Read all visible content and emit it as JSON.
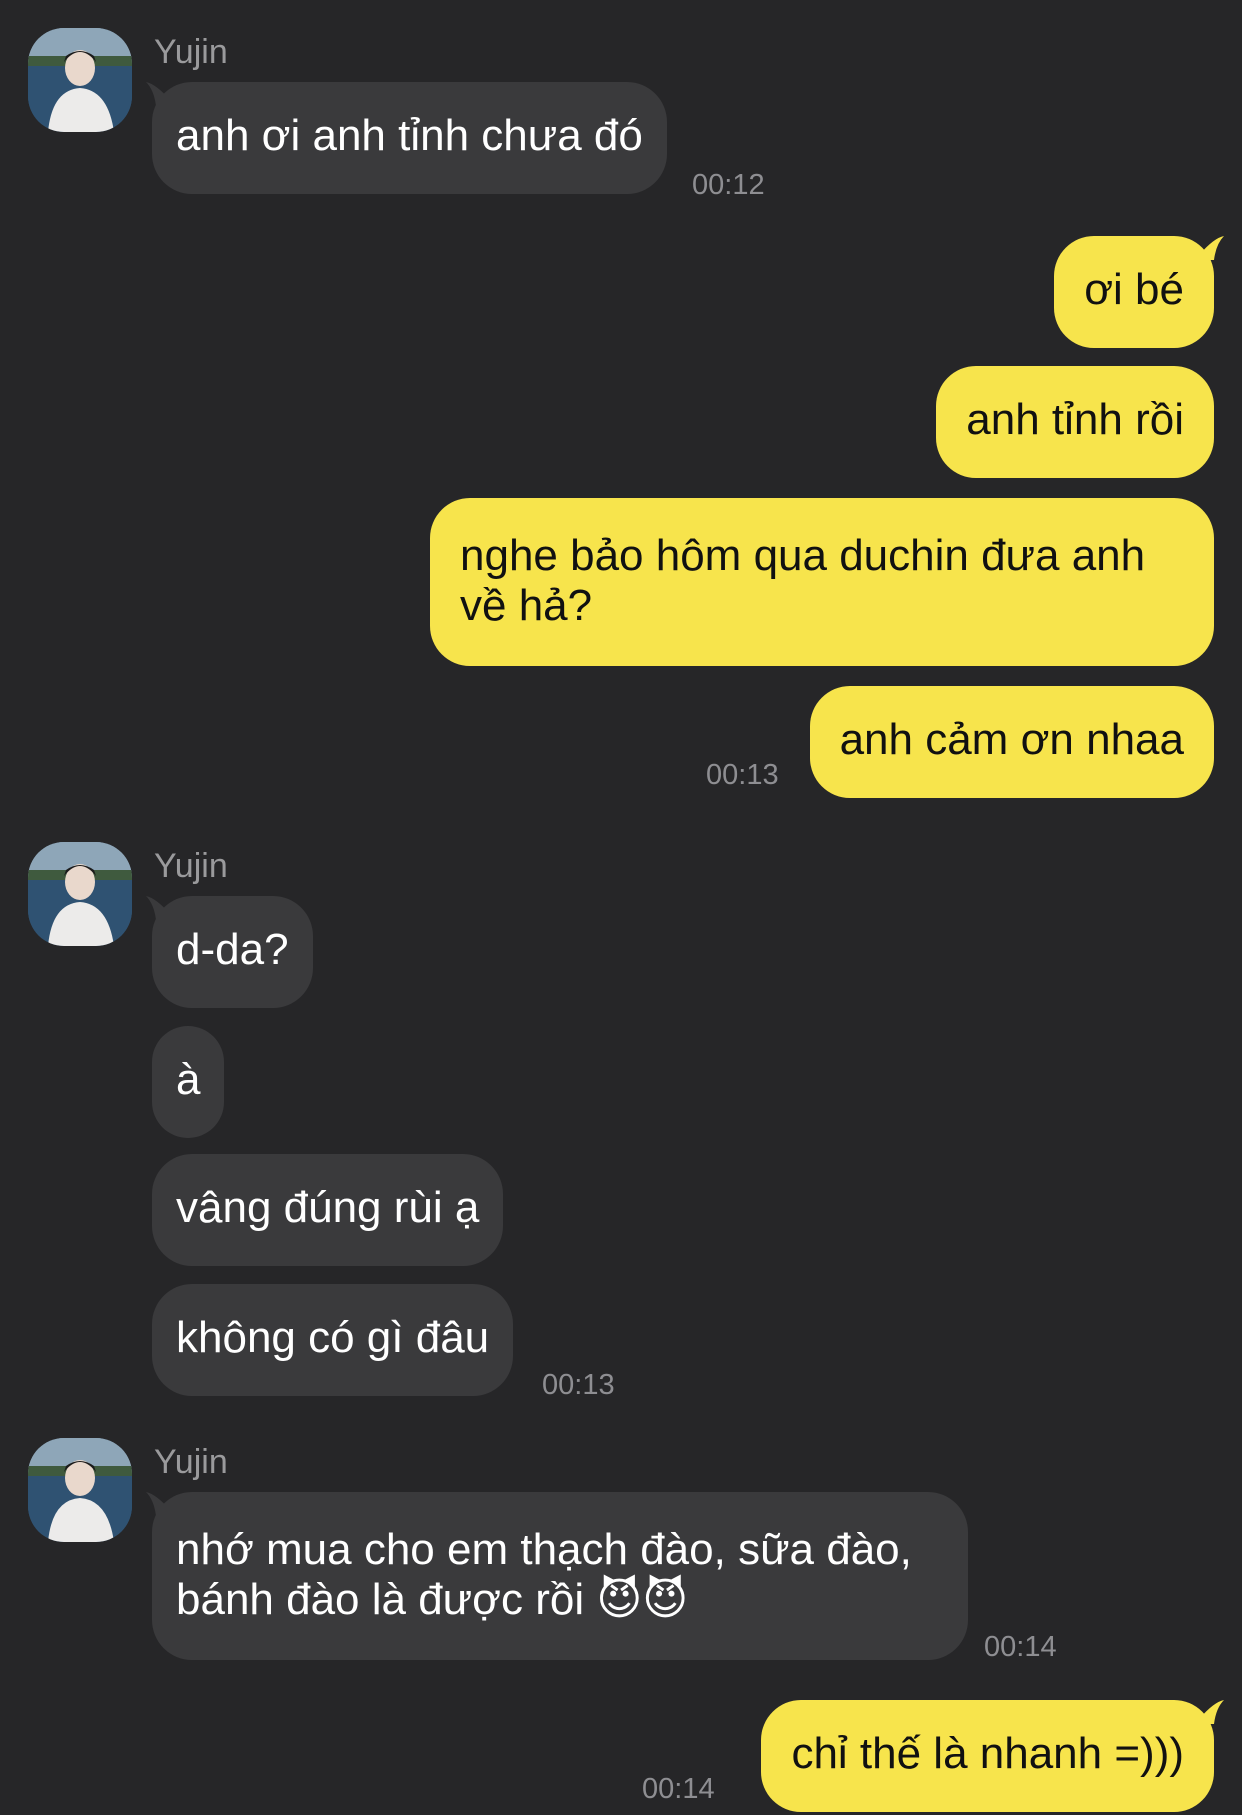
{
  "contact": {
    "name": "Yujin"
  },
  "colors": {
    "background": "#262628",
    "incoming_bubble": "#3a3a3c",
    "outgoing_bubble": "#f7e44c",
    "timestamp": "#8e8e92"
  },
  "groups": [
    {
      "sender": "Yujin",
      "direction": "incoming",
      "messages": [
        "anh ơi anh tỉnh chưa đó"
      ],
      "time": "00:12"
    },
    {
      "direction": "outgoing",
      "messages": [
        "ơi bé",
        "anh tỉnh rồi",
        "nghe bảo hôm qua duchin đưa anh về hả?",
        "anh cảm ơn nhaa"
      ],
      "time": "00:13"
    },
    {
      "sender": "Yujin",
      "direction": "incoming",
      "messages": [
        "d-da?",
        "à",
        "vâng đúng rùi ạ",
        "không có gì đâu"
      ],
      "time": "00:13"
    },
    {
      "sender": "Yujin",
      "direction": "incoming",
      "messages": [
        "nhớ mua cho em thạch đào, sữa đào, bánh đào là được rồi 😈😈"
      ],
      "time": "00:14"
    },
    {
      "direction": "outgoing",
      "messages": [
        "chỉ thế là nhanh =)))"
      ],
      "time": "00:14"
    }
  ]
}
